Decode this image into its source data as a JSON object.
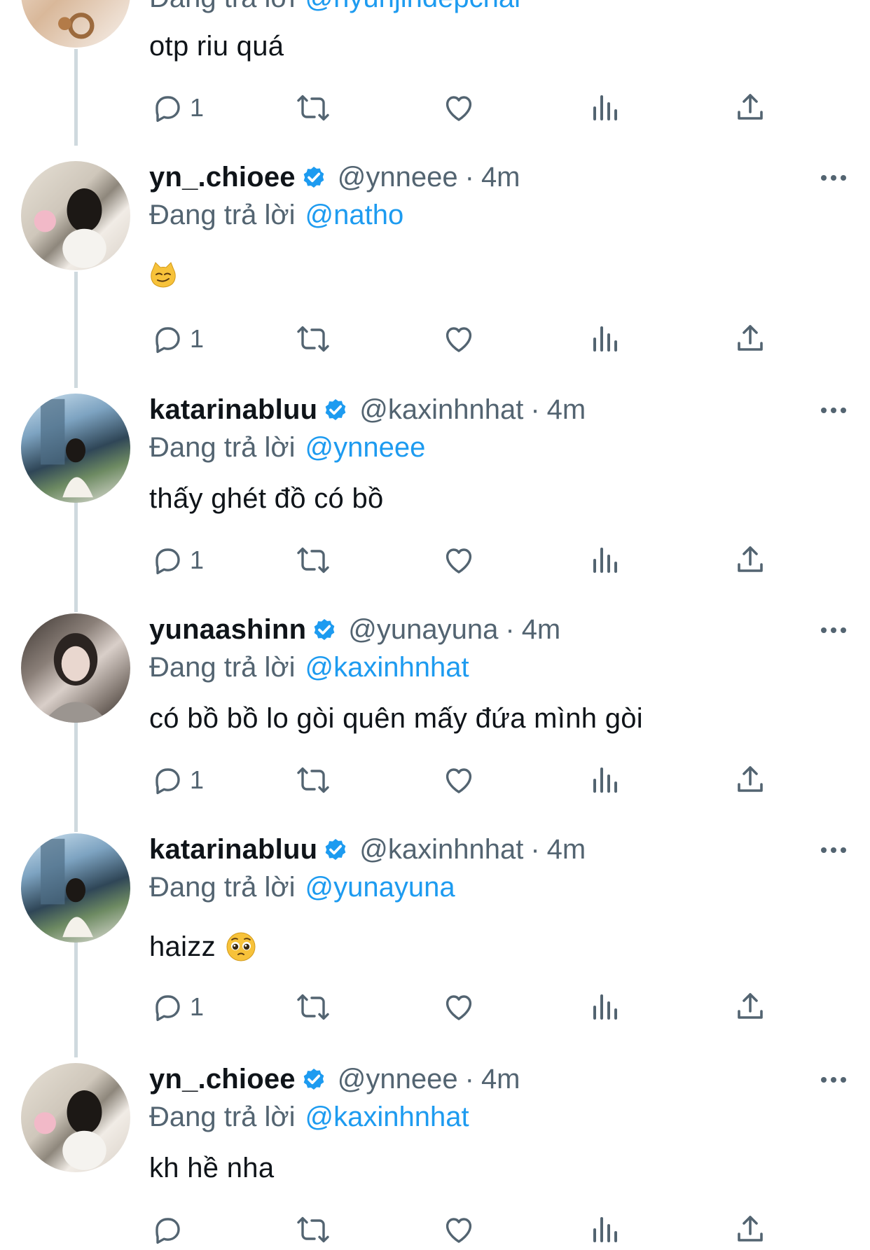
{
  "reply_prefix": "Đang trả lời",
  "tweets": [
    {
      "name": "",
      "handle": "@hyunjindepchai",
      "time": "",
      "reply_to": "@hyunjindepchai",
      "text": "otp riu quá",
      "reply_count": "1",
      "avatar": "top-avatar"
    },
    {
      "name": "yn_.chioee",
      "handle": "@ynneee",
      "time": "4m",
      "reply_to": "@natho",
      "text": "",
      "emoji": "smirk-cat-emoji",
      "reply_count": "1",
      "avatar": "chioee-avatar"
    },
    {
      "name": "katarinabluu",
      "handle": "@kaxinhnhat",
      "time": "4m",
      "reply_to": "@ynneee",
      "text": "thấy ghét đồ có bồ",
      "reply_count": "1",
      "avatar": "katarina-avatar"
    },
    {
      "name": "yunaashinn",
      "handle": "@yunayuna",
      "time": "4m",
      "reply_to": "@kaxinhnhat",
      "text": "có bồ bồ lo gòi quên mấy đứa mình gòi",
      "reply_count": "1",
      "avatar": "yuna-avatar"
    },
    {
      "name": "katarinabluu",
      "handle": "@kaxinhnhat",
      "time": "4m",
      "reply_to": "@yunayuna",
      "text": "haizz",
      "emoji": "pleading-face-emoji",
      "reply_count": "1",
      "avatar": "katarina-avatar"
    },
    {
      "name": "yn_.chioee",
      "handle": "@ynneee",
      "time": "4m",
      "reply_to": "@kaxinhnhat",
      "text": "kh hề nha",
      "reply_count": "",
      "avatar": "chioee-avatar"
    }
  ],
  "colors": {
    "text": "#0f1419",
    "secondary": "#536471",
    "accent": "#1d9bf0",
    "thread_line": "#cfd9de"
  },
  "icons": [
    "reply-icon",
    "retweet-icon",
    "like-icon",
    "views-icon",
    "share-icon",
    "verified-badge-icon",
    "more-options-icon"
  ]
}
